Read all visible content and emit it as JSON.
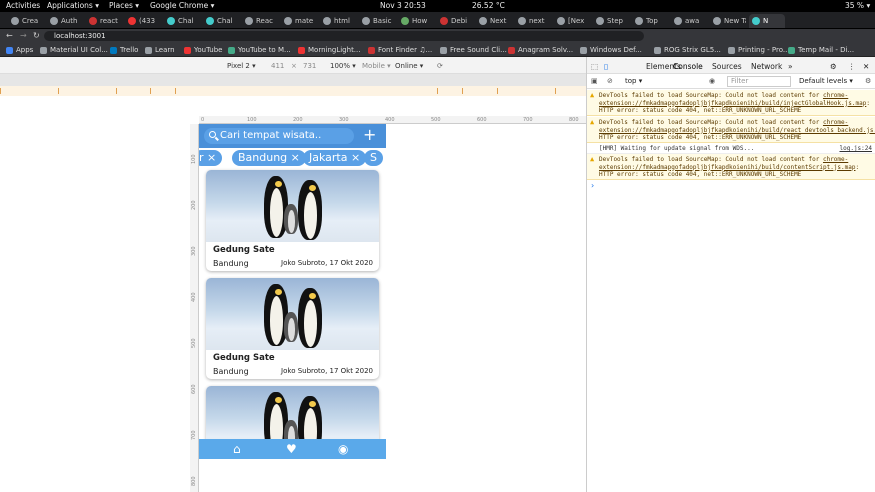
{
  "os": {
    "activities": "Activities",
    "applications": "Applications ▾",
    "places": "Places ▾",
    "app": "Google Chrome ▾",
    "clock": "Nov 3  20:53",
    "weather": "26.52 °C",
    "battery": "35 % ▾"
  },
  "tabs": [
    {
      "label": "Crea",
      "color": "#9aa0a6"
    },
    {
      "label": "Auth",
      "color": "#9aa0a6"
    },
    {
      "label": "react",
      "color": "#c33"
    },
    {
      "label": "(433",
      "color": "#e33"
    },
    {
      "label": "Chal",
      "color": "#4cc"
    },
    {
      "label": "Chal",
      "color": "#4cc"
    },
    {
      "label": "Reac",
      "color": "#9aa0a6"
    },
    {
      "label": "mate",
      "color": "#9aa0a6"
    },
    {
      "label": "html",
      "color": "#9aa0a6"
    },
    {
      "label": "Basic",
      "color": "#9aa0a6"
    },
    {
      "label": "How",
      "color": "#6a6"
    },
    {
      "label": "Debi",
      "color": "#c33"
    },
    {
      "label": "Next",
      "color": "#9aa0a6"
    },
    {
      "label": "next",
      "color": "#9aa0a6"
    },
    {
      "label": "[Nex",
      "color": "#9aa0a6"
    },
    {
      "label": "Step",
      "color": "#9aa0a6"
    },
    {
      "label": "Top",
      "color": "#9aa0a6"
    },
    {
      "label": "awa",
      "color": "#9aa0a6"
    },
    {
      "label": "New Tal",
      "color": "#9aa0a6"
    },
    {
      "label": "N",
      "color": "#4cc",
      "active": true
    }
  ],
  "omnibox": {
    "url": "localhost:3001"
  },
  "bookmarks": [
    {
      "label": "Apps",
      "color": "#4285f4"
    },
    {
      "label": "Material UI Col...",
      "color": "#9aa0a6"
    },
    {
      "label": "Trello",
      "color": "#0079bf"
    },
    {
      "label": "Learn",
      "color": "#9aa0a6"
    },
    {
      "label": "YouTube",
      "color": "#e33"
    },
    {
      "label": "YouTube to M...",
      "color": "#4a8"
    },
    {
      "label": "MorningLight...",
      "color": "#e33"
    },
    {
      "label": "Font Finder ♫...",
      "color": "#c33"
    },
    {
      "label": "Free Sound Cli...",
      "color": "#9aa0a6"
    },
    {
      "label": "Anagram Solv...",
      "color": "#c33"
    },
    {
      "label": "Windows Def...",
      "color": "#9aa0a6"
    },
    {
      "label": "ROG Strix GL5...",
      "color": "#9aa0a6"
    },
    {
      "label": "Printing - Pro...",
      "color": "#9aa0a6"
    },
    {
      "label": "Temp Mail - Di...",
      "color": "#4a8"
    }
  ],
  "device": {
    "name": "Pixel 2 ▾",
    "width": "411",
    "x": "×",
    "height": "731",
    "zoom": "100% ▾",
    "mode": "Mobile ▾",
    "network": "Online ▾"
  },
  "ruler_top": [
    "0",
    "100",
    "200",
    "300",
    "400",
    "500",
    "600",
    "700",
    "800"
  ],
  "ruler_left": [
    "100",
    "200",
    "300",
    "400",
    "500",
    "600",
    "700",
    "800"
  ],
  "app": {
    "search_placeholder": "Cari tempat wisata..",
    "add": "+",
    "chips": [
      "r ×",
      "Bandung ×",
      "Jakarta ×",
      "S"
    ],
    "cards": [
      {
        "title": "Gedung Sate",
        "city": "Bandung",
        "meta": "Joko Subroto, 17 Okt 2020"
      },
      {
        "title": "Gedung Sate",
        "city": "Bandung",
        "meta": "Joko Subroto, 17 Okt 2020"
      },
      {
        "title": "",
        "city": "",
        "meta": ""
      }
    ]
  },
  "devtools": {
    "tabs": [
      "Elements",
      "Console",
      "Sources",
      "Network",
      "»"
    ],
    "context": "top ▾",
    "filter_placeholder": "Filter",
    "levels": "Default levels ▾",
    "messages": [
      {
        "type": "warn",
        "text": "DevTools failed to load SourceMap: Could not load content for ",
        "link": "chrome-extension://fmkadmapgofadopljbjfkapdkoienihi/build/injectGlobalHook.js.map",
        "tail": ": HTTP error: status code 404, net::ERR_UNKNOWN_URL_SCHEME"
      },
      {
        "type": "warn",
        "text": "DevTools failed to load SourceMap: Could not load content for ",
        "link": "chrome-extension://fmkadmapgofadopljbjfkapdkoienihi/build/react_devtools_backend.js.map",
        "tail": ": HTTP error: status code 404, net::ERR_UNKNOWN_URL_SCHEME"
      },
      {
        "type": "info",
        "text": "[HMR] Waiting for update signal from WDS...",
        "link": "log.js:24"
      },
      {
        "type": "warn",
        "text": "DevTools failed to load SourceMap: Could not load content for ",
        "link": "chrome-extension://fmkadmapgofadopljbjfkapdkoienihi/build/contentScript.js.map",
        "tail": ": HTTP error: status code 404, net::ERR_UNKNOWN_URL_SCHEME"
      }
    ]
  }
}
